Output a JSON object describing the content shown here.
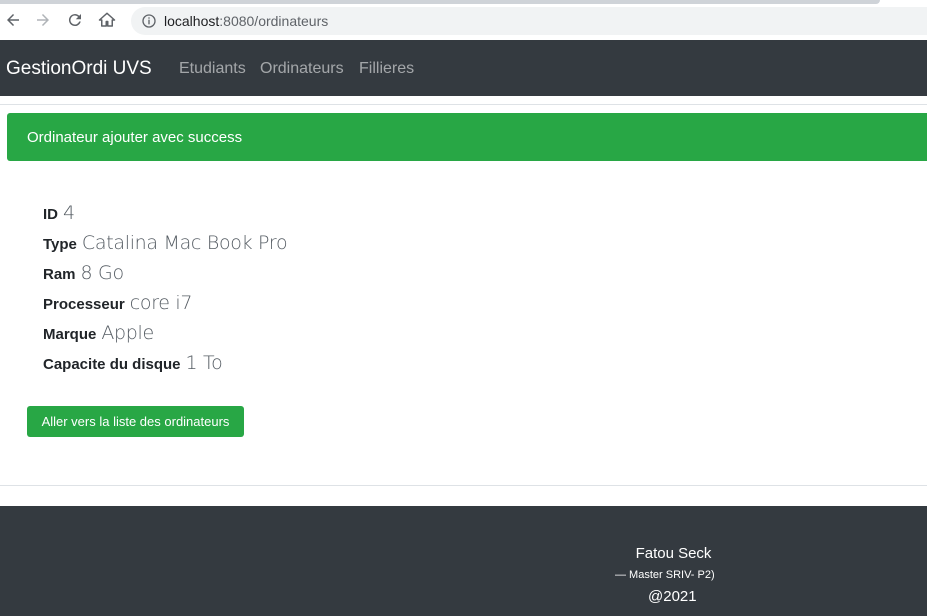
{
  "browser": {
    "url_host": "localhost",
    "url_rest": ":8080/ordinateurs"
  },
  "navbar": {
    "brand": "GestionOrdi UVS",
    "links": [
      "Etudiants",
      "Ordinateurs",
      "Fillieres"
    ]
  },
  "alert": {
    "message": "Ordinateur ajouter avec success",
    "color": "#28a745"
  },
  "details": [
    {
      "label": "ID",
      "value": "4"
    },
    {
      "label": "Type",
      "value": "Catalina Mac Book Pro"
    },
    {
      "label": "Ram",
      "value": "8 Go"
    },
    {
      "label": "Processeur",
      "value": "core i7"
    },
    {
      "label": "Marque",
      "value": "Apple"
    },
    {
      "label": "Capacite du disque",
      "value": "1 To"
    }
  ],
  "button": {
    "label": "Aller vers la liste des ordinateurs"
  },
  "footer": {
    "name": "Fatou Seck",
    "subtitle": "—  Master SRIV- P2)",
    "year": "@2021"
  },
  "colors": {
    "navbar": "#343a40",
    "success": "#28a745"
  }
}
